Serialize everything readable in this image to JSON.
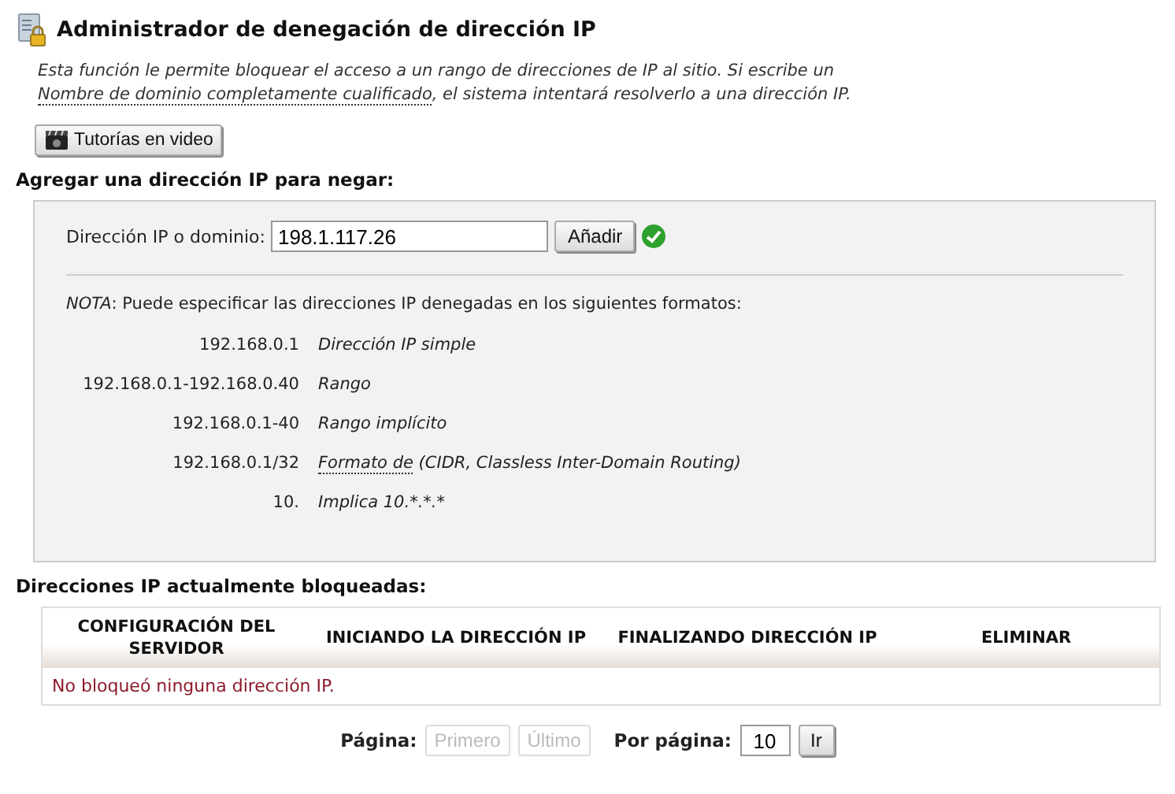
{
  "page_title": "Administrador de denegación de dirección IP",
  "description": {
    "before": "Esta función le permite bloquear el acceso a un rango de direcciones de IP al sitio. Si escribe un ",
    "link": "Nombre de dominio completamente cualificado",
    "after": ", el sistema intentará resolverlo a una dirección IP."
  },
  "video_button": "Tutorías en video",
  "add_section": {
    "heading": "Agregar una dirección IP para negar:",
    "field_label": "Dirección IP o dominio:",
    "field_value": "198.1.117.26",
    "add_button": "Añadir",
    "valid": true,
    "note": {
      "label": "NOTA",
      "text": ": Puede especificar las direcciones IP denegadas en los siguientes formatos:"
    },
    "formats": [
      {
        "example": "192.168.0.1",
        "desc": "Dirección IP simple"
      },
      {
        "example": "192.168.0.1-192.168.0.40",
        "desc": "Rango"
      },
      {
        "example": "192.168.0.1-40",
        "desc": "Rango implícito"
      },
      {
        "example": "192.168.0.1/32",
        "link": "Formato de",
        "desc": " (CIDR, Classless Inter-Domain Routing)"
      },
      {
        "example": "10.",
        "desc": "Implica 10.*.*.*"
      }
    ]
  },
  "blocked_section": {
    "heading": "Direcciones IP actualmente bloqueadas:",
    "columns": [
      "CONFIGURACIÓN DEL SERVIDOR",
      "INICIANDO LA DIRECCIÓN IP",
      "FINALIZANDO DIRECCIÓN IP",
      "ELIMINAR"
    ],
    "empty_message": "No bloqueó ninguna dirección IP."
  },
  "pagination": {
    "page_label": "Página:",
    "buttons": [
      {
        "label": "Primero",
        "disabled": true
      },
      {
        "label": "Último",
        "disabled": true
      }
    ],
    "per_page_label": "Por página:",
    "per_page_value": "10",
    "go_button": "Ir"
  }
}
